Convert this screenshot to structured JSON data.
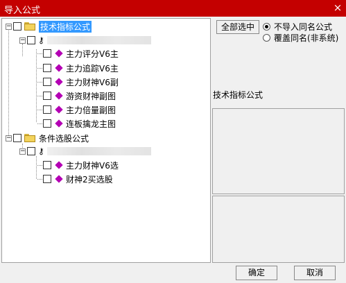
{
  "window": {
    "title": "导入公式",
    "close_glyph": "×"
  },
  "tree": {
    "group1": {
      "label": "技术指标公式",
      "items": [
        "主力评分V6主",
        "主力追踪V6主",
        "主力财神V6副",
        "游资财神副图",
        "主力倍量副图",
        "连板擒龙主图"
      ]
    },
    "group2": {
      "label": "条件选股公式",
      "items": [
        "主力财神V6选",
        "财神2买选股"
      ]
    }
  },
  "right": {
    "select_all_label": "全部选中",
    "radio_options": [
      "不导入同名公式",
      "覆盖同名(非系统)"
    ],
    "radio_selected": 0,
    "info_title": "技术指标公式"
  },
  "footer": {
    "ok_label": "确定",
    "cancel_label": "取消"
  },
  "colors": {
    "titlebar": "#c40000",
    "selection": "#3399ff",
    "formula_icon": "#b400b4"
  },
  "icons": {
    "folder": "folder-icon",
    "key": "key-icon",
    "formula": "formula-icon",
    "expand": "collapse-icon"
  }
}
